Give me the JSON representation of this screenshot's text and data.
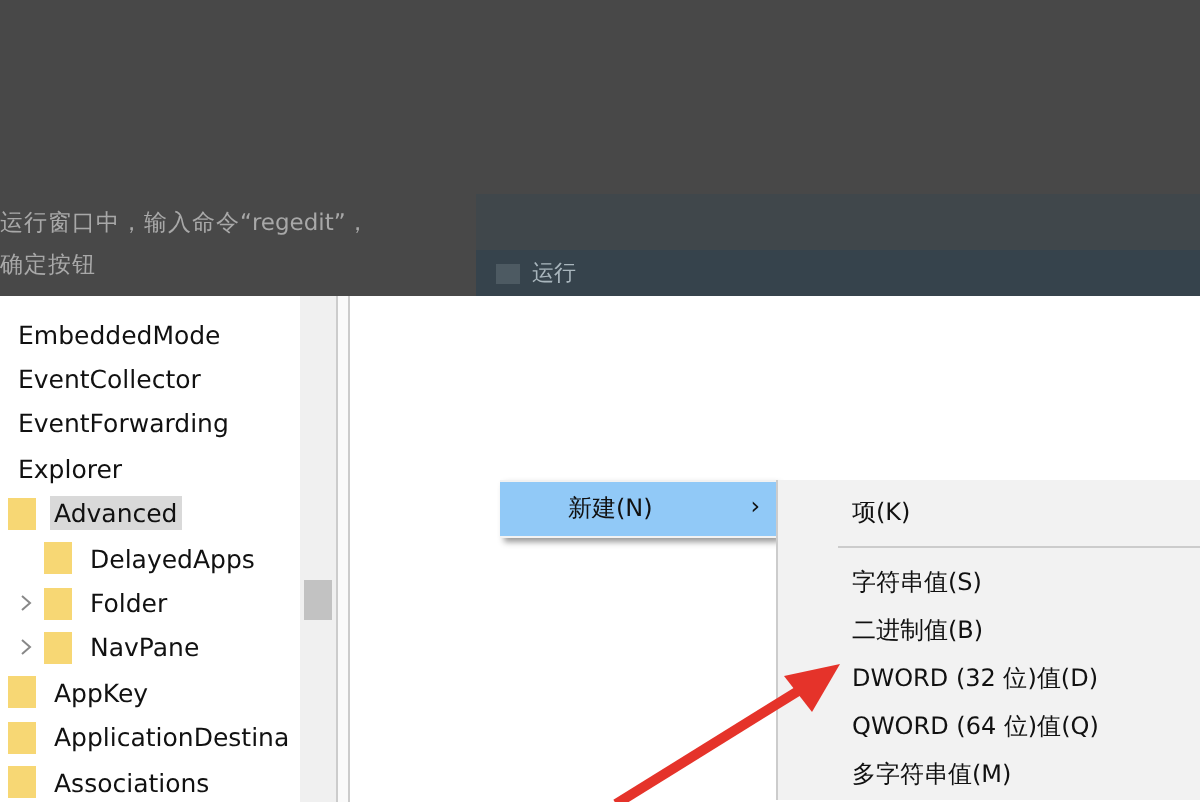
{
  "article": {
    "lines": [
      "运行窗口中，输入命令“regedit”，",
      "确定按钮"
    ]
  },
  "run_dialog": {
    "title": "运行"
  },
  "tree": [
    {
      "label": "EmbeddedMode"
    },
    {
      "label": "EventCollector"
    },
    {
      "label": "EventForwarding"
    },
    {
      "label": "Explorer",
      "children": [
        {
          "label": "Advanced",
          "selected": true,
          "children": [
            {
              "label": "DelayedApps",
              "selected": false
            },
            {
              "label": "Folder",
              "selected": false,
              "expanded": false
            },
            {
              "label": "NavPane",
              "selected": false,
              "expanded": false
            }
          ]
        },
        {
          "label": "AppKey",
          "selected": false
        },
        {
          "label": "ApplicationDestina",
          "selected": false
        },
        {
          "label": "Associations",
          "selected": false
        }
      ]
    }
  ],
  "context_menu": {
    "items": [
      {
        "label": "新建(N)",
        "arrow": "›",
        "selected": true
      }
    ]
  },
  "submenu": {
    "items": [
      {
        "kind": "item",
        "label": "项(K)"
      },
      {
        "kind": "separator"
      },
      {
        "kind": "item",
        "label": "字符串值(S)"
      },
      {
        "kind": "item",
        "label": "二进制值(B)"
      },
      {
        "kind": "item",
        "label": "DWORD (32 位)值(D)"
      },
      {
        "kind": "item",
        "label": "QWORD (64 位)值(Q)"
      },
      {
        "kind": "item",
        "label": "多字符串值(M)"
      }
    ]
  }
}
